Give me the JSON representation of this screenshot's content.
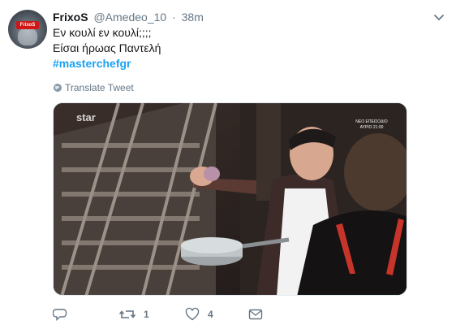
{
  "tweet": {
    "author_name": "FrixoS",
    "author_handle": "@Amedeo_10",
    "separator": "·",
    "timestamp": "38m",
    "avatar_text": "FrixoS",
    "lines": [
      "Εν κουλί εν κουλί;;;;",
      "Είσαι ήρωας Παντελή"
    ],
    "hashtag": "#masterchefgr",
    "translate_label": "Translate Tweet"
  },
  "media": {
    "watermark": "star",
    "overlay_line1": "ΝΕΟ ΕΠΕΙΣΟΔΙΟ",
    "overlay_line2": "ΑΥΡΙΟ 21:00"
  },
  "actions": {
    "reply_count": "",
    "retweet_count": "1",
    "like_count": "4"
  },
  "colors": {
    "link": "#1da1f2",
    "muted": "#657786",
    "text": "#14171a"
  }
}
